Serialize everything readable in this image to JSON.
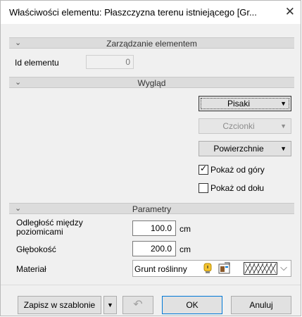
{
  "window": {
    "title": "Właściwości elementu: Płaszczyzna terenu istniejącego [Gr...",
    "close_glyph": "✕"
  },
  "sections": {
    "management": {
      "title": "Zarządzanie elementem",
      "chevron": "⌄"
    },
    "appearance": {
      "title": "Wygląd",
      "chevron": "⌄"
    },
    "parameters": {
      "title": "Parametry",
      "chevron": "⌄"
    }
  },
  "management": {
    "id_label": "Id elementu",
    "id_value": "0"
  },
  "appearance": {
    "pens_label": "Pisaki",
    "fonts_label": "Czcionki",
    "surfaces_label": "Powierzchnie",
    "dropdown_arrow": "▼",
    "show_top_label": "Pokaż od góry",
    "show_top_checked": true,
    "show_bottom_label": "Pokaż od dołu",
    "show_bottom_checked": false,
    "check_glyph": "✓"
  },
  "parameters": {
    "level_distance_label_1": "Odległość między",
    "level_distance_label_2": "poziomicami",
    "level_distance_value": "100.0",
    "level_distance_unit": "cm",
    "depth_label": "Głębokość",
    "depth_value": "200.0",
    "depth_unit": "cm",
    "material_label": "Materiał",
    "material_value": "Grunt roślinny",
    "material_chevron": "⌵"
  },
  "footer": {
    "save_template_label": "Zapisz w szablonie",
    "save_template_arrow": "▼",
    "undo_glyph": "↶",
    "ok_label": "OK",
    "cancel_label": "Anuluj"
  },
  "colors": {
    "section_bg": "#dcdcdc",
    "window_bg": "#f0f0f0",
    "accent_blue": "#0078d7",
    "bulb_yellow": "#f4c430"
  }
}
